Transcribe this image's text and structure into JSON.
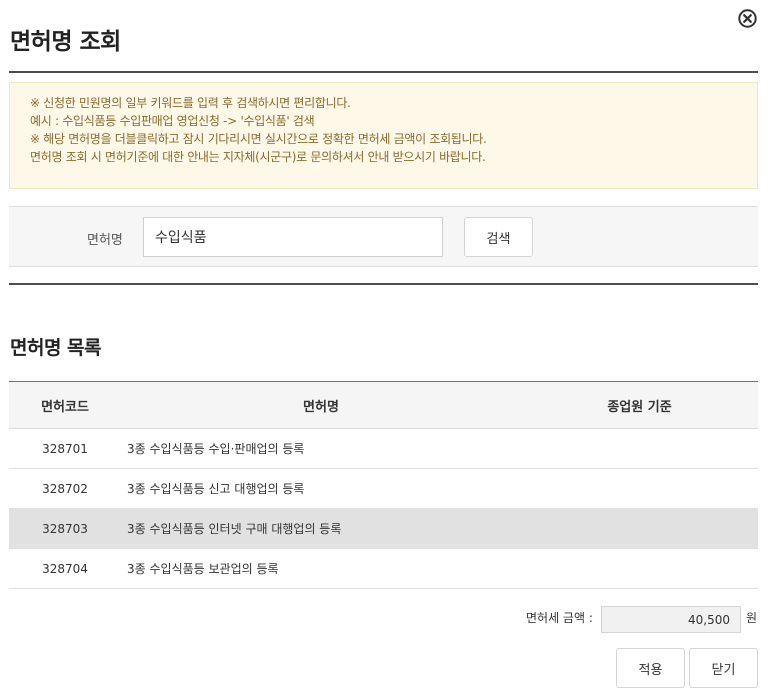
{
  "header": {
    "title": "면허명 조회",
    "close_icon": "close-circle-icon"
  },
  "notice": {
    "lines": [
      "※ 신청한 민원명의 일부 키워드를 입력 후 검색하시면 편리합니다.",
      "예시 : 수입식품등 수입판매업 영업신청 -> '수입식품' 검색",
      "※ 해당 면허명을 더블클릭하고 잠시 기다리시면 실시간으로 정확한 면허세 금액이 조회됩니다.",
      "면허명 조회 시 면허기준에 대한 안내는 지자체(시군구)로 문의하셔서 안내 받으시기 바랍니다."
    ]
  },
  "search": {
    "label": "면허명",
    "value": "수입식품",
    "button_label": "검색"
  },
  "list": {
    "title": "면허명 목록",
    "columns": [
      "면허코드",
      "면허명",
      "종업원 기준"
    ],
    "rows": [
      {
        "code": "328701",
        "name": "3종 수입식품등 수입·판매업의 등록",
        "staff": "",
        "selected": false
      },
      {
        "code": "328702",
        "name": "3종 수입식품등 신고 대행업의 등록",
        "staff": "",
        "selected": false
      },
      {
        "code": "328703",
        "name": "3종 수입식품등 인터넷 구매 대행업의 등록",
        "staff": "",
        "selected": true
      },
      {
        "code": "328704",
        "name": "3종 수입식품등 보관업의 등록",
        "staff": "",
        "selected": false
      }
    ]
  },
  "fee": {
    "label": "면허세 금액 :",
    "value": "40,500",
    "unit": "원"
  },
  "buttons": {
    "apply": "적용",
    "close": "닫기"
  },
  "colors": {
    "table_top_border": "#b85a3c",
    "notice_bg": "#fdf8e8",
    "notice_text": "#8a6a2d",
    "selected_row_bg": "#e1e1e1"
  }
}
